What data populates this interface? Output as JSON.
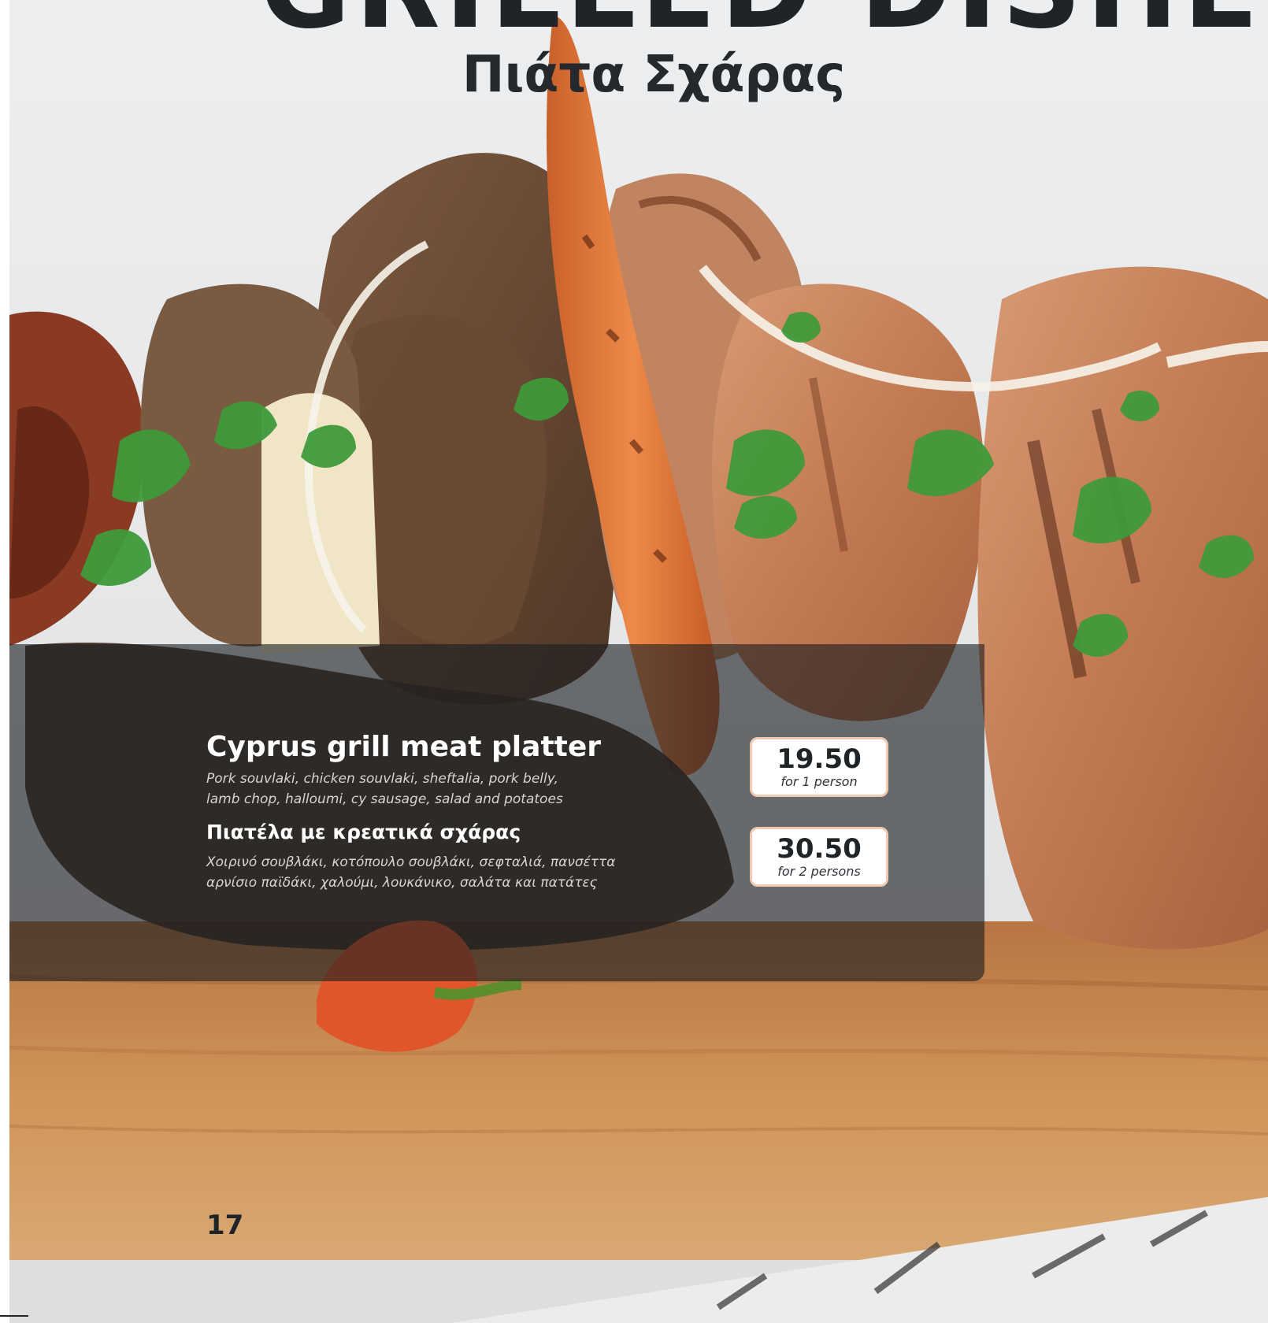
{
  "header": {
    "title": "GRILLED DISHES",
    "subtitle": "Πιάτα Σχάρας"
  },
  "dish": {
    "name_en": "Cyprus grill meat platter",
    "description_en_line1": "Pork souvlaki, chicken souvlaki, sheftalia, pork belly,",
    "description_en_line2": "lamb chop, halloumi, cy sausage, salad and potatoes",
    "name_gr": "Πιατέλα με κρεατικά σχάρας",
    "description_gr_line1": "Χοιρινό σουβλάκι, κοτόπουλο σουβλάκι, σεφταλιά, πανσέττα",
    "description_gr_line2": "αρνίσιο παϊδάκι, χαλούμι, λουκάνικο, σαλάτα και πατάτες"
  },
  "prices": [
    {
      "value": "19.50",
      "note": "for 1 person"
    },
    {
      "value": "30.50",
      "note": "for 2 persons"
    }
  ],
  "footer": {
    "page_number": "17"
  },
  "colors": {
    "title_text": "#1f2429",
    "panel_overlay": "#1c1e22",
    "price_border": "#f1c9b0",
    "board_wood": "#c98a4e",
    "carrot": "#e07a3c",
    "parsley": "#3f9a3a"
  }
}
